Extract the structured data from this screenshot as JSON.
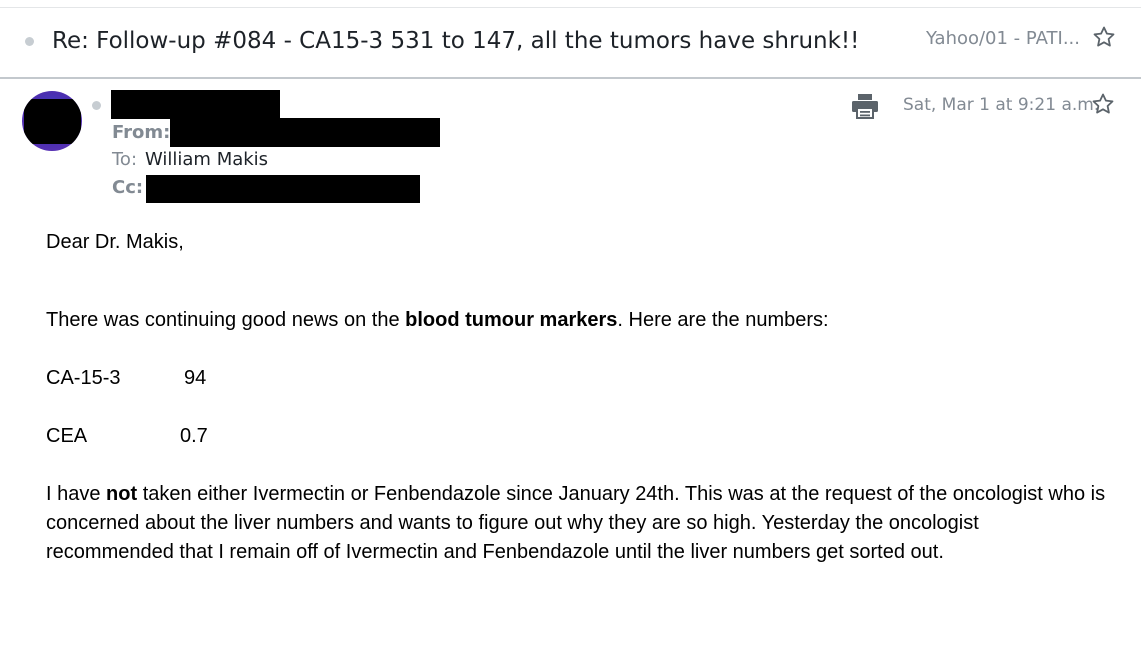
{
  "message": {
    "subject": "Re: Follow-up #084 - CA15-3 531 to 147, all the tumors have shrunk!!",
    "folder": "Yahoo/01 - PATI...",
    "header": {
      "from_label": "From:",
      "to_label": "To:",
      "to_value": "William Makis",
      "cc_label": "Cc:",
      "date": "Sat, Mar 1 at 9:21 a.m."
    },
    "body": {
      "greeting": "Dear Dr. Makis,",
      "para1_pre": "There was continuing good news on the ",
      "para1_bold": "blood tumour markers",
      "para1_post": ".  Here are the numbers:",
      "markers": [
        {
          "name": "CA-15-3",
          "value": "94"
        },
        {
          "name": "CEA",
          "value": "0.7"
        }
      ],
      "para2_pre": "I have ",
      "para2_bold": "not",
      "para2_post": " taken either Ivermectin or Fenbendazole since January 24th.  This was at the request of the oncologist who is concerned about the liver numbers and wants to figure out why they are so high.  Yesterday the oncologist recommended that I remain off of Ivermectin and Fenbendazole until the liver numbers get sorted out."
    }
  },
  "icons": {
    "star": "star-outline-icon",
    "print": "printer-icon",
    "unread": "dot-icon"
  },
  "colors": {
    "muted_text": "#828a93",
    "divider": "#c3c8cd",
    "redaction": "#000000"
  }
}
